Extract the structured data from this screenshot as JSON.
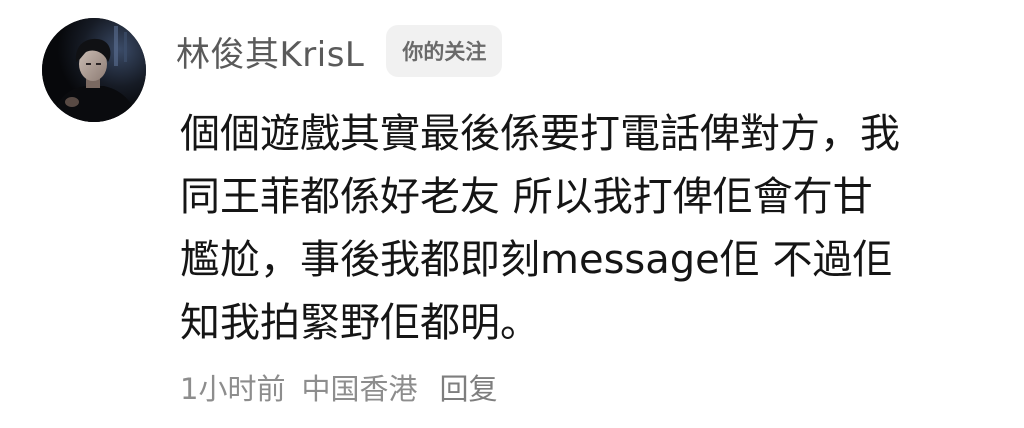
{
  "comment": {
    "username": "林俊其KrisL",
    "follow_badge": "你的关注",
    "content_lines": [
      "個個遊戲其實最後係要打電話俾對方，我",
      "同王菲都係好老友 所以我打俾佢會冇甘",
      "尷尬，事後我都即刻message佢 不過佢",
      "知我拍緊野佢都明。"
    ],
    "time": "1小时前",
    "location": "中国香港",
    "reply_label": "回复"
  },
  "colors": {
    "username": "#5a5a5a",
    "badge_bg": "#f1f1f1",
    "badge_text": "#6a6a6a",
    "content_text": "#151515",
    "meta_text": "#8d8d8d"
  },
  "icons": {
    "avatar": "user-avatar-photo"
  }
}
